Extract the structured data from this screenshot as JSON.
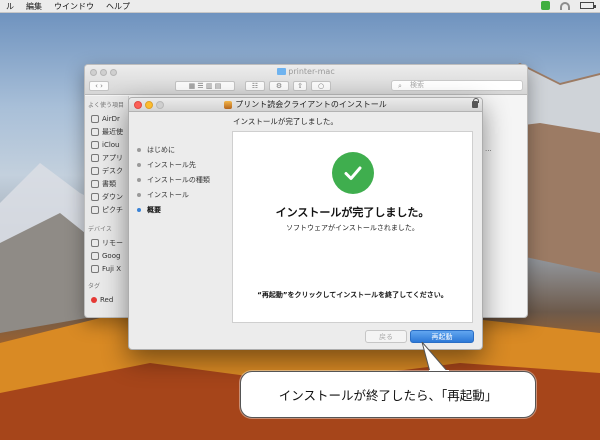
{
  "menubar": {
    "items": [
      "ル",
      "編集",
      "ウインドウ",
      "ヘルプ"
    ]
  },
  "finder": {
    "title": "printer-mac",
    "search_placeholder": "検索",
    "sidebar": {
      "favorites_header": "よく使う項目",
      "items": [
        "AirDr",
        "最近使",
        "iClou",
        "アプリ",
        "デスク",
        "書類",
        "ダウン",
        "ピクチ"
      ],
      "devices_header": "デバイス",
      "devices": [
        "リモー",
        "Goog",
        "Fuji X"
      ],
      "tags_header": "タグ",
      "tags": [
        "Red"
      ]
    },
    "partial_text": "..."
  },
  "installer": {
    "title": "プリント読会クライアントのインストール",
    "subtitle": "インストールが完了しました。",
    "steps": [
      "はじめに",
      "インストール先",
      "インストールの種類",
      "インストール",
      "概要"
    ],
    "active_step_index": 4,
    "main_heading": "インストールが完了しました。",
    "main_sub": "ソフトウェアがインストールされました。",
    "instruction": "“再起動”をクリックしてインストールを終了してください。",
    "buttons": {
      "back": "戻る",
      "restart": "再起動"
    }
  },
  "callout": {
    "text": "インストールが終了したら、「再起動」"
  },
  "colors": {
    "accent": "#2d79d7",
    "success": "#3fae4e",
    "tag_red": "#e53935"
  }
}
